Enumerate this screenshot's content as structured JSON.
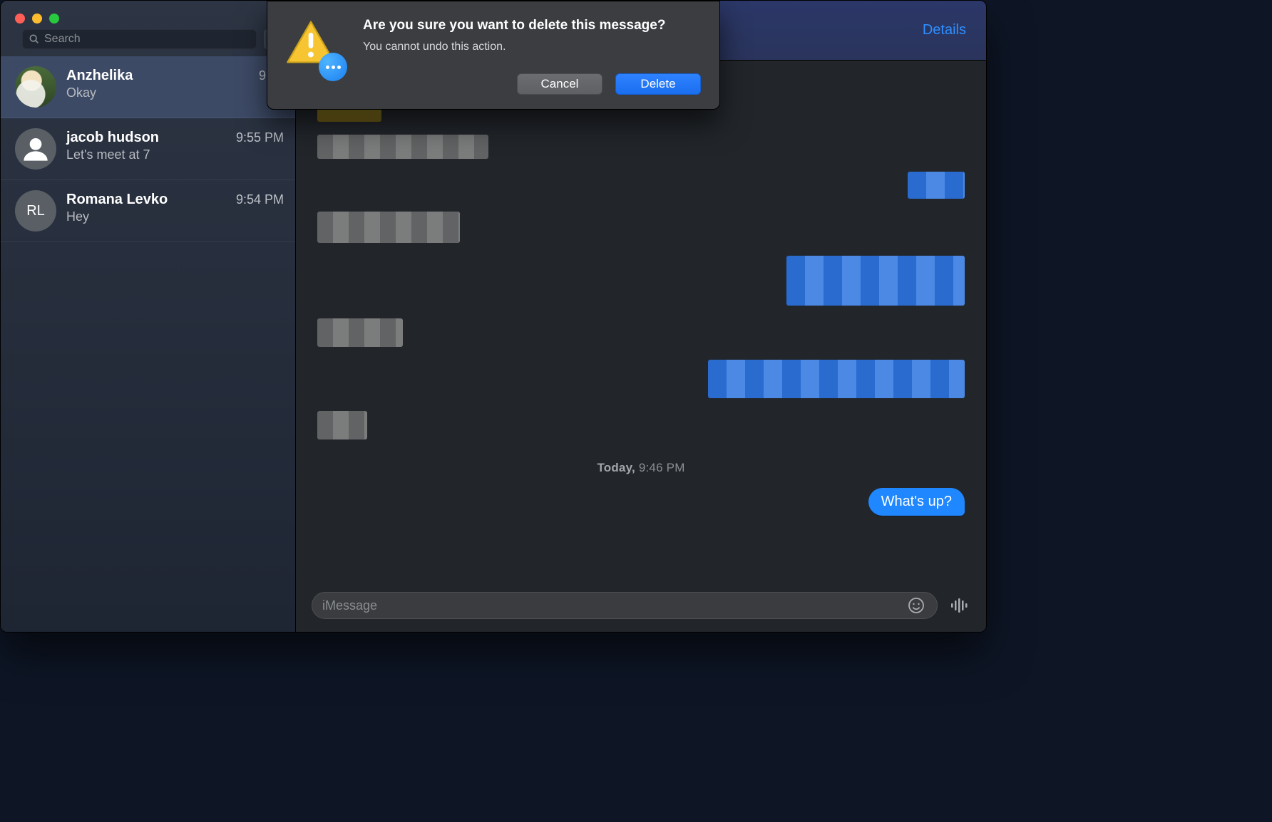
{
  "search": {
    "placeholder": "Search"
  },
  "header": {
    "details": "Details"
  },
  "conversations": [
    {
      "name": "Anzhelika",
      "time": "9:56",
      "preview": "Okay",
      "avatar_type": "photo",
      "initials": ""
    },
    {
      "name": "jacob hudson",
      "time": "9:55 PM",
      "preview": "Let's meet at 7",
      "avatar_type": "silhouette",
      "initials": ""
    },
    {
      "name": "Romana Levko",
      "time": "9:54 PM",
      "preview": "Hey",
      "avatar_type": "initials",
      "initials": "RL"
    }
  ],
  "thread": {
    "timestamp_prefix": "Today,",
    "timestamp_time": "9:46 PM",
    "last_sent": "What's up?"
  },
  "composer": {
    "placeholder": "iMessage"
  },
  "dialog": {
    "title": "Are you sure you want to delete this message?",
    "body": "You cannot undo this action.",
    "cancel": "Cancel",
    "delete": "Delete"
  },
  "icons": {
    "search": "search-icon",
    "compose": "compose-icon",
    "emoji": "emoji-icon",
    "audio": "audio-waveform-icon",
    "warning": "warning-icon",
    "messages": "messages-app-icon"
  }
}
